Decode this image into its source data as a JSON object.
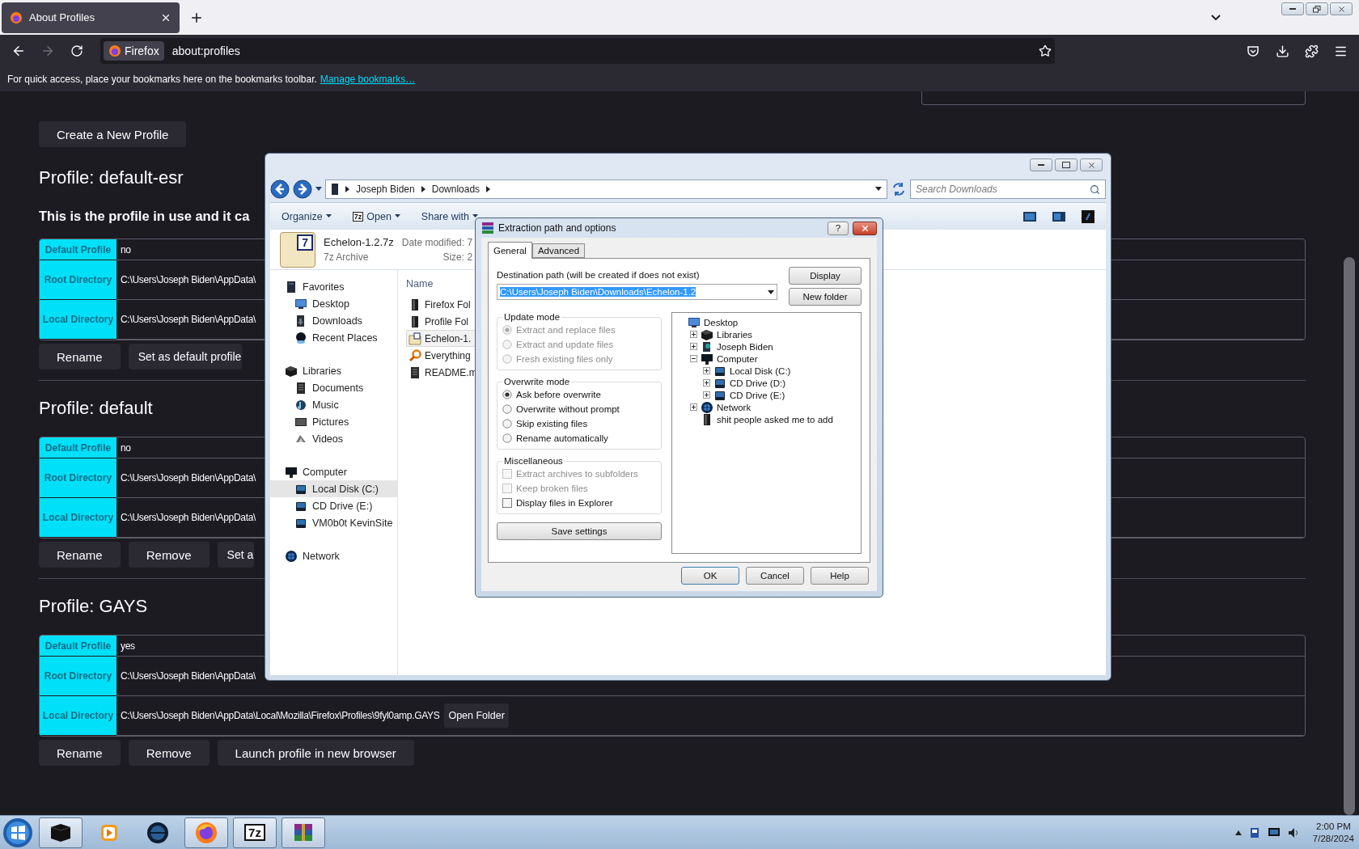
{
  "browser": {
    "tabs": [
      {
        "title": "About Profiles",
        "selected": true
      }
    ],
    "url_chip": "Firefox",
    "url": "about:profiles",
    "bookmarks_hint": "For quick access, place your bookmarks here on the bookmarks toolbar.",
    "bookmarks_link": "Manage bookmarks…"
  },
  "page": {
    "create_button": "Create a New Profile",
    "profiles": [
      {
        "heading": "Profile: default-esr",
        "note": "This is the profile in use and it ca",
        "rows": [
          {
            "label": "Default Profile",
            "value": "no"
          },
          {
            "label": "Root Directory",
            "value": "C:\\Users\\Joseph Biden\\AppData\\"
          },
          {
            "label": "Local Directory",
            "value": "C:\\Users\\Joseph Biden\\AppData\\"
          }
        ],
        "buttons": [
          {
            "label": "Rename",
            "clipped": false
          },
          {
            "label": "Set as default profile",
            "clipped": true
          }
        ]
      },
      {
        "heading": "Profile: default",
        "rows": [
          {
            "label": "Default Profile",
            "value": "no"
          },
          {
            "label": "Root Directory",
            "value": "C:\\Users\\Joseph Biden\\AppData\\"
          },
          {
            "label": "Local Directory",
            "value": "C:\\Users\\Joseph Biden\\AppData\\"
          }
        ],
        "buttons": [
          {
            "label": "Rename",
            "clipped": false
          },
          {
            "label": "Remove",
            "clipped": false
          },
          {
            "label": "Set a",
            "clipped": true
          }
        ]
      },
      {
        "heading": "Profile: GAYS",
        "rows": [
          {
            "label": "Default Profile",
            "value": "yes"
          },
          {
            "label": "Root Directory",
            "value": "C:\\Users\\Joseph Biden\\AppData\\"
          },
          {
            "label": "Local Directory",
            "value": "C:\\Users\\Joseph Biden\\AppData\\Local\\Mozilla\\Firefox\\Profiles\\9fyl0amp.GAYS",
            "button": "Open Folder"
          }
        ],
        "buttons": [
          {
            "label": "Rename",
            "clipped": false
          },
          {
            "label": "Remove",
            "clipped": false
          },
          {
            "label": "Launch profile in new browser",
            "clipped": false
          }
        ]
      }
    ]
  },
  "explorer": {
    "breadcrumb": [
      "Joseph Biden",
      "Downloads"
    ],
    "search_placeholder": "Search Downloads",
    "toolbar": [
      {
        "label": "Organize"
      },
      {
        "label": "Open",
        "badge": "7z"
      },
      {
        "label": "Share with"
      }
    ],
    "details": {
      "icon_text": "7",
      "name": "Echelon-1.2.7z",
      "type": "7z Archive",
      "modified_label": "Date modified: 7",
      "size_label": "Size: 2"
    },
    "nav": [
      {
        "label": "Favorites",
        "kind": "favorites",
        "items": [
          {
            "label": "Desktop",
            "kind": "desktop",
            "selected": false
          },
          {
            "label": "Downloads",
            "kind": "downloads",
            "selected": false
          },
          {
            "label": "Recent Places",
            "kind": "recent",
            "selected": false
          }
        ]
      },
      {
        "label": "Libraries",
        "kind": "libraries",
        "items": [
          {
            "label": "Documents",
            "kind": "document",
            "selected": false
          },
          {
            "label": "Music",
            "kind": "music",
            "selected": false
          },
          {
            "label": "Pictures",
            "kind": "picture",
            "selected": false
          },
          {
            "label": "Videos",
            "kind": "video",
            "selected": false
          }
        ]
      },
      {
        "label": "Computer",
        "kind": "computer",
        "items": [
          {
            "label": "Local Disk (C:)",
            "kind": "drive",
            "selected": true
          },
          {
            "label": "CD Drive (E:)",
            "kind": "drive",
            "selected": false
          },
          {
            "label": "VM0b0t KevinSite",
            "kind": "drive",
            "selected": false
          }
        ]
      },
      {
        "label": "Network",
        "kind": "network"
      }
    ],
    "column_header": "Name",
    "files": [
      {
        "name": "Firefox Fol",
        "kind": "folder",
        "selected": false
      },
      {
        "name": "Profile Fol",
        "kind": "folder",
        "selected": false
      },
      {
        "name": "Echelon-1.",
        "kind": "archive",
        "selected": true
      },
      {
        "name": "Everything",
        "kind": "search",
        "selected": false
      },
      {
        "name": "README.m",
        "kind": "document",
        "selected": false
      }
    ]
  },
  "dialog": {
    "title": "Extraction path and options",
    "help_button": "?",
    "tabs": [
      {
        "label": "General",
        "selected": true
      },
      {
        "label": "Advanced",
        "selected": false
      }
    ],
    "dest_label": "Destination path (will be created if does not exist)",
    "dest_value": "C:\\Users\\Joseph Biden\\Downloads\\Echelon-1.2",
    "dest_selected": true,
    "side_buttons": [
      "Display",
      "New folder"
    ],
    "groups": [
      {
        "title": "Update mode",
        "options": [
          {
            "kind": "radio",
            "label": "Extract and replace files",
            "checked": true,
            "disabled": true
          },
          {
            "kind": "radio",
            "label": "Extract and update files",
            "checked": false,
            "disabled": true
          },
          {
            "kind": "radio",
            "label": "Fresh existing files only",
            "checked": false,
            "disabled": true
          }
        ]
      },
      {
        "title": "Overwrite mode",
        "options": [
          {
            "kind": "radio",
            "label": "Ask before overwrite",
            "checked": true,
            "disabled": false
          },
          {
            "kind": "radio",
            "label": "Overwrite without prompt",
            "checked": false,
            "disabled": false
          },
          {
            "kind": "radio",
            "label": "Skip existing files",
            "checked": false,
            "disabled": false
          },
          {
            "kind": "radio",
            "label": "Rename automatically",
            "checked": false,
            "disabled": false
          }
        ]
      },
      {
        "title": "Miscellaneous",
        "options": [
          {
            "kind": "checkbox",
            "label": "Extract archives to subfolders",
            "checked": false,
            "disabled": true
          },
          {
            "kind": "checkbox",
            "label": "Keep broken files",
            "checked": false,
            "disabled": true
          },
          {
            "kind": "checkbox",
            "label": "Display files in Explorer",
            "checked": false,
            "disabled": false
          }
        ]
      }
    ],
    "save_button": "Save settings",
    "tree": {
      "label": "Desktop",
      "kind": "desktop",
      "children": [
        {
          "label": "Libraries",
          "kind": "libraries",
          "expanded": false
        },
        {
          "label": "Joseph Biden",
          "kind": "user",
          "expanded": false
        },
        {
          "label": "Computer",
          "kind": "computer",
          "expanded": true,
          "children": [
            {
              "label": "Local Disk (C:)",
              "kind": "drive",
              "expanded": false
            },
            {
              "label": "CD Drive (D:)",
              "kind": "drive",
              "expanded": false
            },
            {
              "label": "CD Drive (E:)",
              "kind": "drive",
              "expanded": false
            }
          ]
        },
        {
          "label": "Network",
          "kind": "network",
          "expanded": false
        },
        {
          "label": "shit people asked me to add",
          "kind": "folder"
        }
      ]
    },
    "buttons": [
      "OK",
      "Cancel",
      "Help"
    ]
  },
  "taskbar": {
    "apps": [
      {
        "kind": "device",
        "running": true
      },
      {
        "kind": "media",
        "running": false
      },
      {
        "kind": "globe",
        "running": false
      },
      {
        "kind": "browser",
        "running": true
      },
      {
        "kind": "archiver",
        "label": "7z",
        "running": true
      },
      {
        "kind": "books",
        "running": true
      }
    ],
    "time": "2:00 PM",
    "date": "7/28/2024"
  }
}
